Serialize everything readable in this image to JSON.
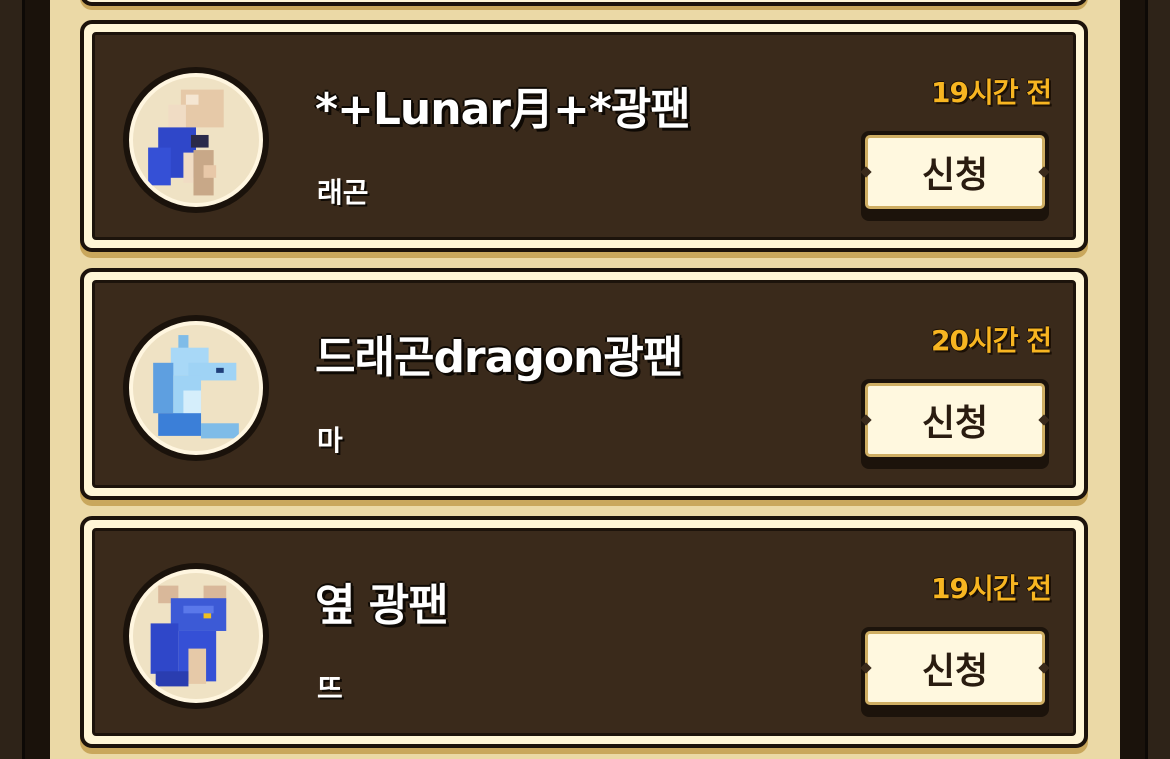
{
  "requests": [
    {
      "name": "*+Lunar月+*광팬",
      "message": "래곤",
      "time": "19시간 전",
      "button_label": "신청",
      "avatar_icon": "white-blue-dragon-avatar-icon",
      "colors": {
        "avatar_main": "#e8c8a8",
        "avatar_accent": "#2f47c9"
      }
    },
    {
      "name": "드래곤dragon광팬",
      "message": "마",
      "time": "20시간 전",
      "button_label": "신청",
      "avatar_icon": "light-blue-dragon-avatar-icon",
      "colors": {
        "avatar_main": "#9fd3f5",
        "avatar_accent": "#3b7fd8"
      }
    },
    {
      "name": "옆 광팬",
      "message": "뜨",
      "time": "19시간 전",
      "button_label": "신청",
      "avatar_icon": "blue-dragon-avatar-icon",
      "colors": {
        "avatar_main": "#3c5ad6",
        "avatar_accent": "#d9b89a"
      }
    }
  ],
  "colors": {
    "time_text": "#f7b521",
    "card_bg": "#3a2a1b",
    "panel_bg": "#ebd9a6",
    "button_face": "#fff8df"
  }
}
